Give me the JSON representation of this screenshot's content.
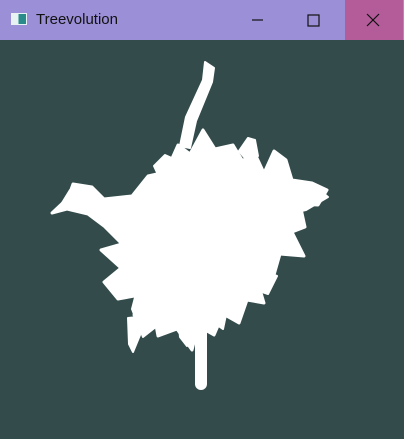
{
  "window": {
    "title": "Treevolution"
  },
  "colors": {
    "titlebar": "#9b8fd7",
    "close_button": "#b45b99",
    "canvas_background": "#334b4b",
    "tree_color": "#ffffff"
  },
  "icons": {
    "app": "treevolution-app-icon",
    "minimize": "minimize-icon",
    "maximize": "maximize-icon",
    "close": "close-icon"
  }
}
